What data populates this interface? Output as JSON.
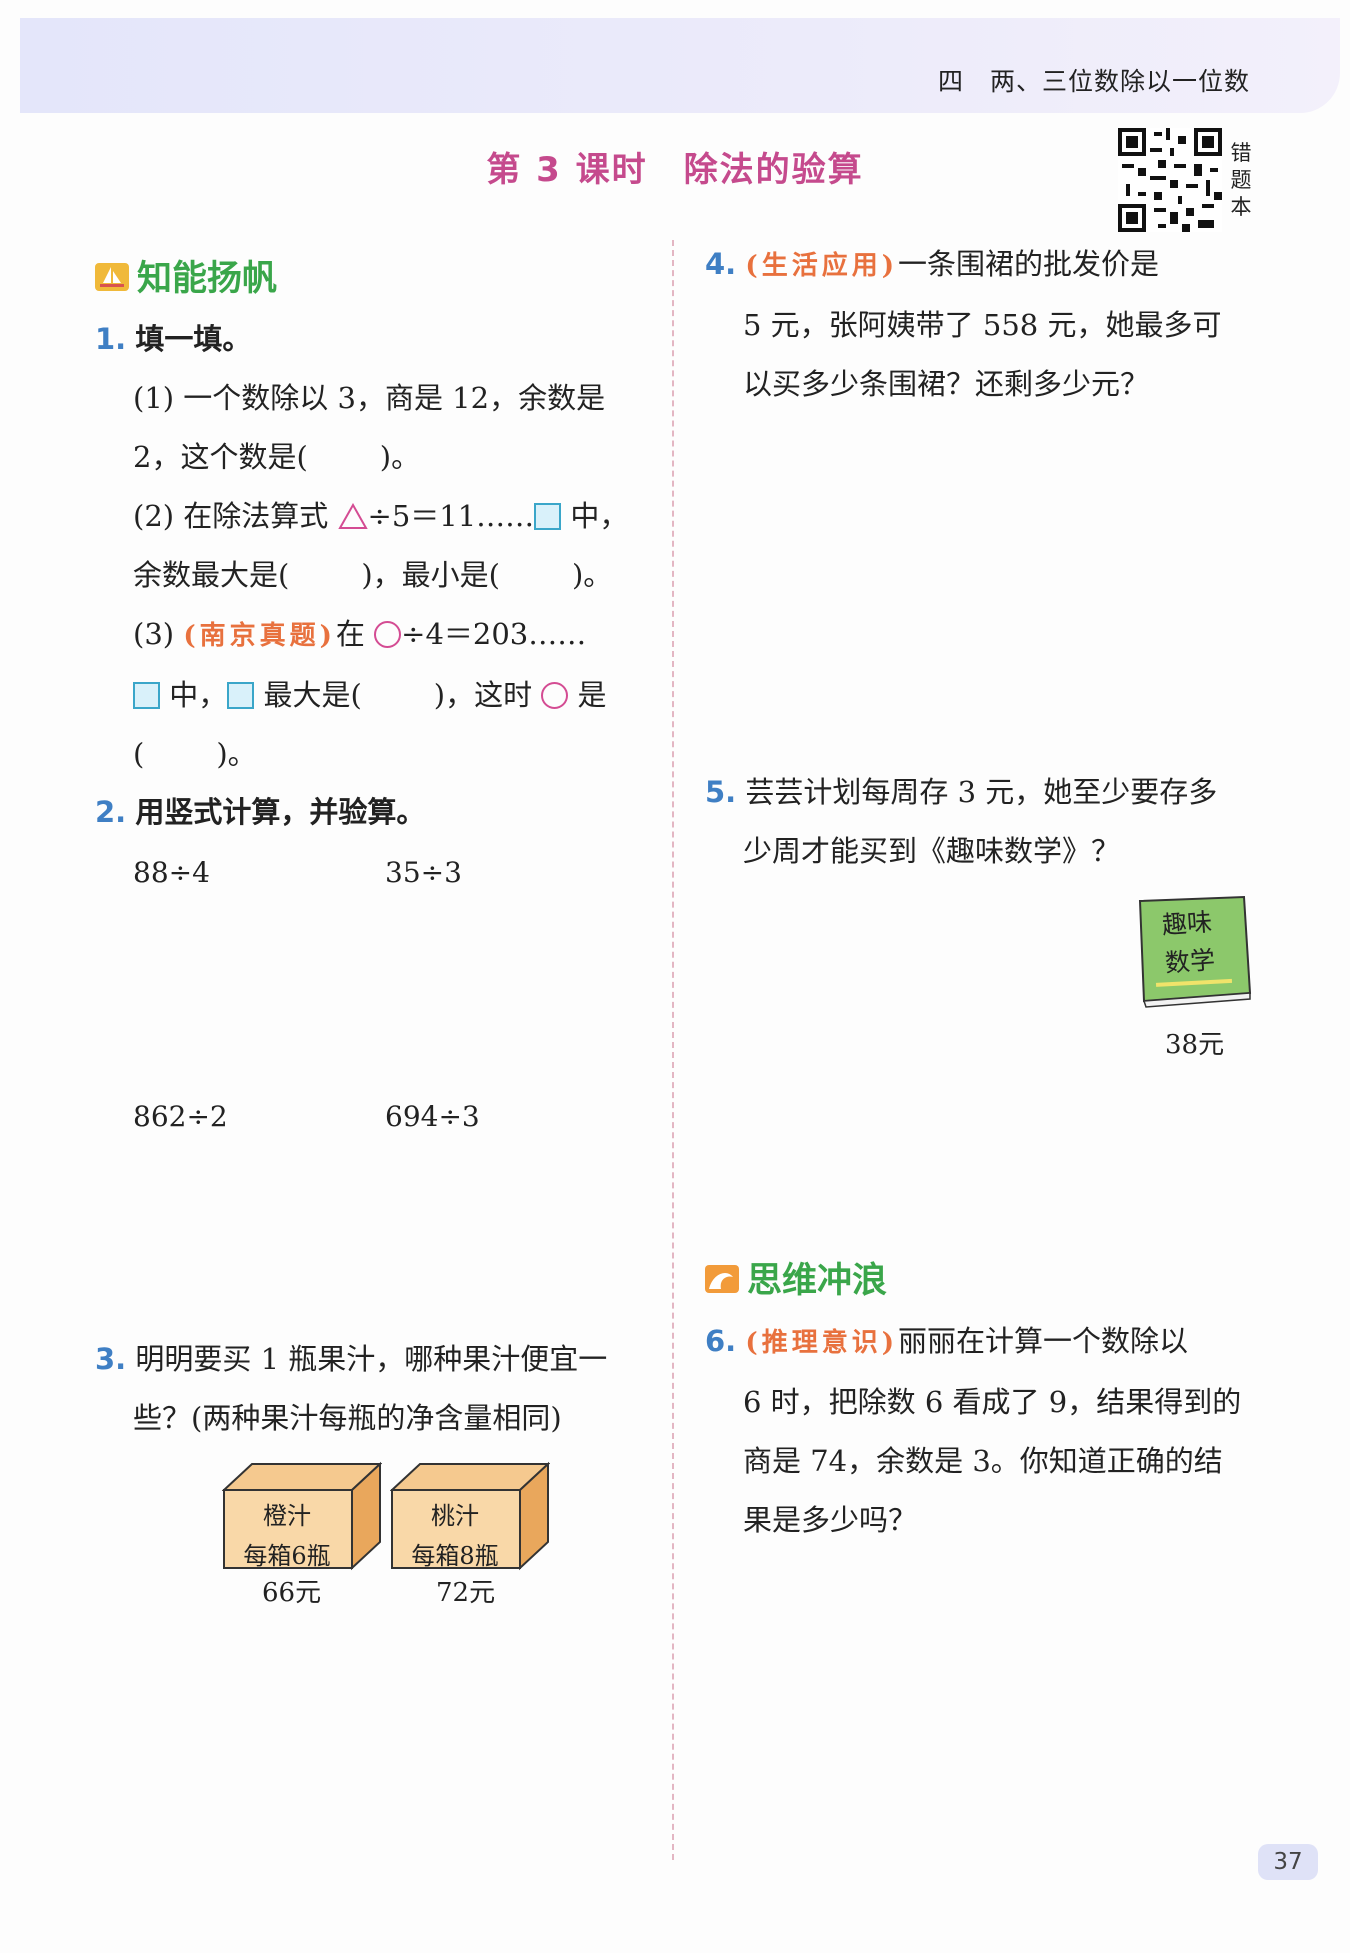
{
  "header": {
    "unit_title": "四　两、三位数除以一位数",
    "lesson_title": "第 3 课时　除法的验算",
    "qr_label": "错题本"
  },
  "sections": {
    "left_title": "知能扬帆",
    "right_title": "思维冲浪",
    "colors": {
      "green": "#3aa64a",
      "blue": "#3f7fc4",
      "orange": "#e8713e",
      "pink": "#c54a8d"
    }
  },
  "q1": {
    "num": "1.",
    "title": "填一填。",
    "p1_line1": "(1) 一个数除以 3，商是 12，余数是",
    "p1_line2a": "2，这个数是(",
    "p1_line2b": ")。",
    "p2_a": "(2) 在除法算式",
    "p2_b": "÷5＝11……",
    "p2_c": "中，",
    "p2_line2a": "余数最大是(",
    "p2_line2b": ")，最小是(",
    "p2_line2c": ")。",
    "p3_a": "(3)",
    "p3_tag": "(南京真题)",
    "p3_b": "在",
    "p3_c": "÷4＝203……",
    "p3_line2a": "中，",
    "p3_line2b": "最大是(",
    "p3_line2c": ")，这时",
    "p3_line2d": "是",
    "p3_line3a": "(",
    "p3_line3b": ")。"
  },
  "q2": {
    "num": "2.",
    "title": "用竖式计算，并验算。",
    "calcs": [
      "88÷4",
      "35÷3",
      "862÷2",
      "694÷3"
    ]
  },
  "q3": {
    "num": "3.",
    "line1": "明明要买 1 瓶果汁，哪种果汁便宜一",
    "line2": "些？(两种果汁每瓶的净含量相同)",
    "box1_name": "橙汁",
    "box1_desc": "每箱6瓶",
    "box1_price": "66元",
    "box2_name": "桃汁",
    "box2_desc": "每箱8瓶",
    "box2_price": "72元"
  },
  "q4": {
    "num": "4.",
    "tag": "(生活应用)",
    "line1": "一条围裙的批发价是",
    "line2": "5 元，张阿姨带了 558 元，她最多可",
    "line3": "以买多少条围裙？还剩多少元？"
  },
  "q5": {
    "num": "5.",
    "line1": "芸芸计划每周存 3 元，她至少要存多",
    "line2": "少周才能买到《趣味数学》？",
    "book_title_1": "趣味",
    "book_title_2": "数学",
    "book_price": "38元"
  },
  "q6": {
    "num": "6.",
    "tag": "(推理意识)",
    "line1": "丽丽在计算一个数除以",
    "line2": "6 时，把除数 6 看成了 9，结果得到的",
    "line3": "商是 74，余数是 3。你知道正确的结",
    "line4": "果是多少吗？"
  },
  "footer": {
    "page_number": "37"
  }
}
